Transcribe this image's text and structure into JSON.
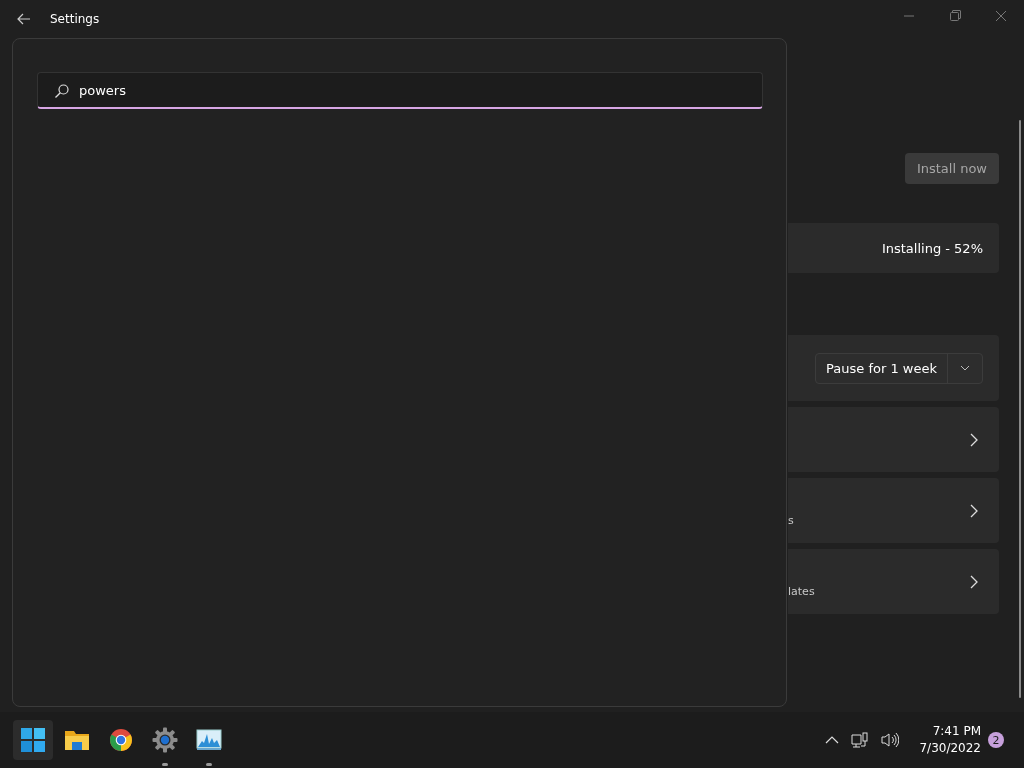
{
  "window": {
    "title": "Settings"
  },
  "search": {
    "value": "powers"
  },
  "update": {
    "install_button": "Install now",
    "status": "Installing - 52%",
    "pause_dropdown": "Pause for 1 week",
    "rows": [
      {},
      {
        "text": "s"
      },
      {
        "text": "lates"
      }
    ]
  },
  "taskbar": {
    "apps": [
      {
        "kind": "start",
        "selected": true,
        "running": false
      },
      {
        "kind": "folder",
        "selected": false,
        "running": false
      },
      {
        "kind": "browser",
        "selected": false,
        "running": false
      },
      {
        "kind": "settings",
        "selected": false,
        "running": true
      },
      {
        "kind": "monitor",
        "selected": false,
        "running": true
      }
    ],
    "time": "7:41 PM",
    "date": "7/30/2022",
    "notification_count": "2"
  }
}
